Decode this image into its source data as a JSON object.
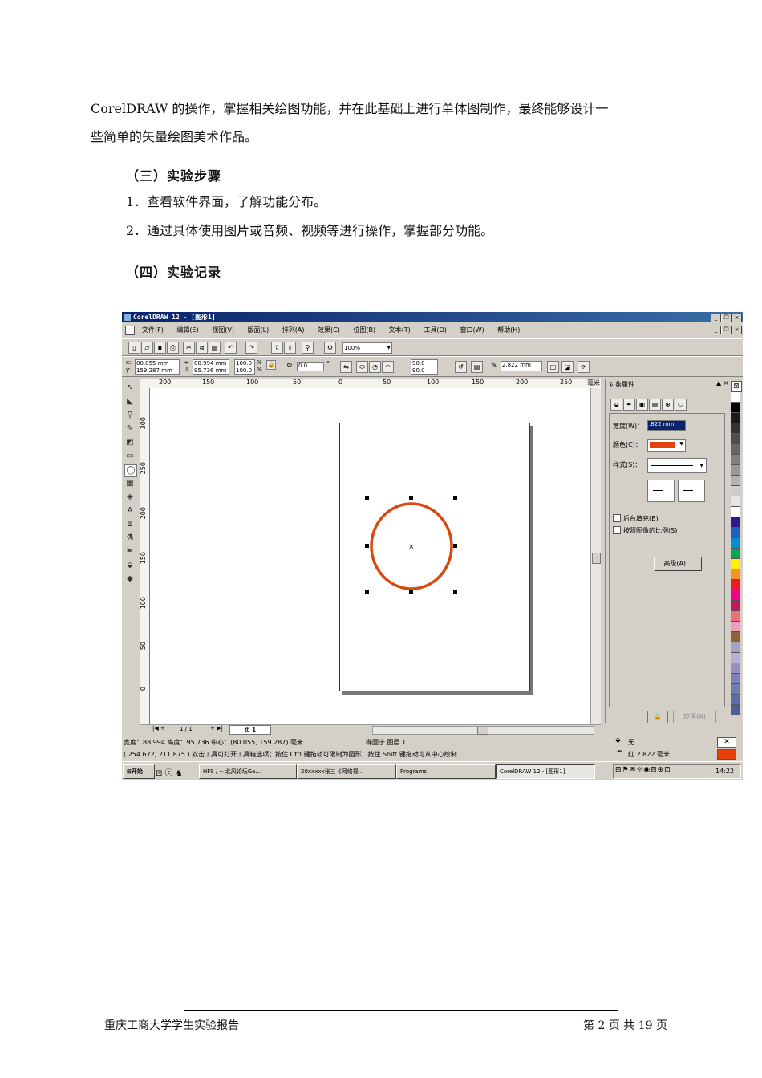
{
  "document": {
    "intro_line1": "CorelDRAW 的操作，掌握相关绘图功能，并在此基础上进行单体图制作，最终能够设计一",
    "intro_line2": "些简单的矢量绘图美术作品。",
    "section3_title": "（三）实验步骤",
    "step1": "1．查看软件界面，了解功能分布。",
    "step2": "2．通过具体使用图片或音频、视频等进行操作，掌握部分功能。",
    "section4_title": "（四）实验记录",
    "footer_left": "重庆工商大学学生实验报告",
    "footer_right": "第 2 页 共 19 页"
  },
  "screenshot": {
    "window_title": "CorelDRAW 12 - [图形1]",
    "menu": [
      "文件(F)",
      "编辑(E)",
      "视图(V)",
      "版面(L)",
      "排列(A)",
      "效果(C)",
      "位图(B)",
      "文本(T)",
      "工具(O)",
      "窗口(W)",
      "帮助(H)"
    ],
    "zoom": "100%",
    "prop_x": "80.055 mm",
    "prop_y": "159.287 mm",
    "prop_w": "88.994 mm",
    "prop_h": "95.736 mm",
    "scale_x": "100.0",
    "scale_y": "100.0",
    "percent": "%",
    "rotation": "0.0",
    "degree": "°",
    "angle_start": "90.0",
    "angle_end": "90.0",
    "outline_width": "2.822 mm",
    "ruler_top": [
      "200",
      "150",
      "100",
      "50",
      "0",
      "50",
      "100",
      "150",
      "200",
      "250"
    ],
    "ruler_unit": "毫米",
    "ruler_left": [
      "300",
      "250",
      "200",
      "150",
      "100",
      "50",
      "0"
    ],
    "page_nav": "1 / 1",
    "page_tab": "页 1",
    "docker_title": "对象属性",
    "docker_width_label": "宽度(W)：",
    "docker_width_value": ".822 mm",
    "docker_color_label": "颜色(C)：",
    "docker_color": "#e8400c",
    "docker_style_label": "样式(S)：",
    "docker_check1": "后台填充(B)",
    "docker_check2": "按照图像的比例(S)",
    "docker_advanced": "高级(A)...",
    "docker_apply": "应用(A)",
    "status_line1": "宽度：88.994 高度：95.736 中心：(80.055, 159.287) 毫米",
    "status_layer": "椭圆于 图层 1",
    "status_line2": "( 254.672, 211.875 )   双击工具可打开工具箱选项；按住 Ctrl 键拖动可限制为圆形；按住 Shift 键拖动可从中心绘制",
    "status_fill": "无",
    "status_outline": "红  2.822 毫米",
    "status_outline_color": "#e8400c",
    "ellipse_color": "#d9480f",
    "start_button": "开始",
    "taskbar_items": [
      "HFS / -- 北风论坛Ga...",
      "20xxxxx张三《网络视...",
      "Programs",
      "CorelDRAW 12 - [图形1]"
    ],
    "clock": "14:22",
    "palette_colors": [
      "#ffffff",
      "#000000",
      "#1a1a1a",
      "#333333",
      "#4d4d4d",
      "#666666",
      "#808080",
      "#999999",
      "#b3b3b3",
      "#cccccc",
      "#e6e6e6",
      "#ffffff",
      "#2e1a8a",
      "#1f5fbf",
      "#0090d0",
      "#00a651",
      "#fff200",
      "#f7941d",
      "#ed1c24",
      "#ec008c",
      "#c2185b",
      "#f26c7d",
      "#f49ac1",
      "#8c6239",
      "#a3a3c2",
      "#b8b0d8",
      "#9a8fc4",
      "#7d83b9",
      "#6a7fb2",
      "#5d6ea8",
      "#4f5f96"
    ]
  }
}
